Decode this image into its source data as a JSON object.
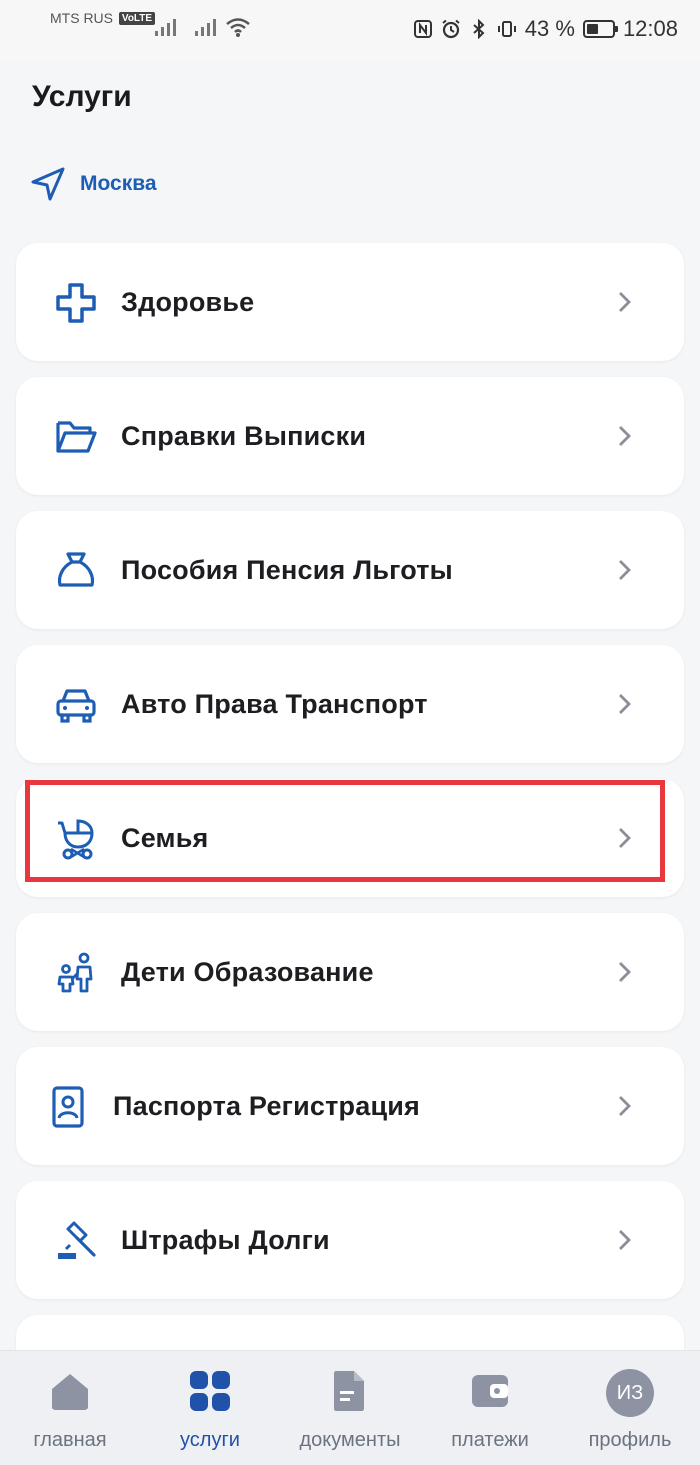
{
  "status_bar": {
    "carrier": "MTS RUS",
    "volte": "VoLTE",
    "battery": "43 %",
    "time": "12:08"
  },
  "header": {
    "title": "Услуги",
    "location": "Москва"
  },
  "services": [
    {
      "label": "Здоровье",
      "icon": "medical-cross-icon"
    },
    {
      "label": "Справки Выписки",
      "icon": "folder-icon"
    },
    {
      "label": "Пособия Пенсия Льготы",
      "icon": "money-bag-icon"
    },
    {
      "label": "Авто Права Транспорт",
      "icon": "car-icon"
    },
    {
      "label": "Семья",
      "icon": "baby-stroller-icon"
    },
    {
      "label": "Дети Образование",
      "icon": "parent-child-icon"
    },
    {
      "label": "Паспорта Регистрация",
      "icon": "passport-icon"
    },
    {
      "label": "Штрафы Долги",
      "icon": "gavel-icon"
    }
  ],
  "highlighted_service": "Семья",
  "colors": {
    "accent": "#1d5db3",
    "highlight": "#e8383e",
    "nav_active": "#1f52a8",
    "nav_inactive": "#8d93a2"
  },
  "bottom_nav": {
    "items": [
      {
        "label": "главная",
        "icon": "home-icon"
      },
      {
        "label": "услуги",
        "icon": "services-grid-icon",
        "active": true
      },
      {
        "label": "документы",
        "icon": "document-icon"
      },
      {
        "label": "платежи",
        "icon": "wallet-icon"
      },
      {
        "label": "профиль",
        "icon": "avatar",
        "initials": "ИЗ"
      }
    ]
  }
}
